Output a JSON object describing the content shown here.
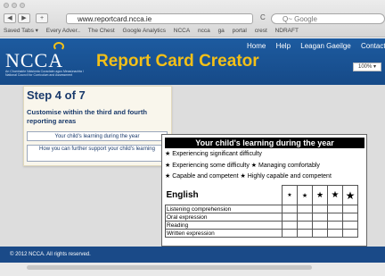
{
  "browser": {
    "back": "◀",
    "forward": "▶",
    "add_tab": "+",
    "url": "www.reportcard.ncca.ie",
    "reload": "C",
    "search_placeholder": "Q~ Google",
    "bookmarks": [
      "Saved Tabs ▾",
      "Every Adver..",
      "The Chest",
      "Google Analytics",
      "NCCA",
      "ncca",
      "ga",
      "portal",
      "crest",
      "NDRAFT"
    ]
  },
  "header": {
    "logo": "NCCA",
    "logo_sub": "An Chomhairle Náisiúnta Curaclaim agus Measúnachta / National Council for Curriculum and Assessment",
    "title": "Report Card Creator",
    "nav": [
      "Home",
      "Help",
      "Leagan Gaeilge",
      "Contact Us"
    ],
    "zoom": "100% ▾"
  },
  "step": {
    "title": "Step 4 of 7",
    "description": "Customise within the third and fourth reporting areas",
    "options": [
      "Your child's learning during the year",
      "How you can further support your child's learning"
    ]
  },
  "card": {
    "title": "Your child's learning during the year",
    "key_lines": [
      "★ Experiencing significant difficulty",
      "★ Experiencing some difficulty ★ Managing comfortably",
      "★ Capable and competent ★ Highly capable and competent"
    ],
    "subject": "English",
    "star_columns": [
      "★",
      "★",
      "★",
      "★",
      "★"
    ],
    "rows": [
      "Listening comprehension",
      "Oral expression",
      "Reading",
      "Written expression"
    ]
  },
  "footer": {
    "copyright": "© 2012 NCCA. All rights reserved."
  }
}
